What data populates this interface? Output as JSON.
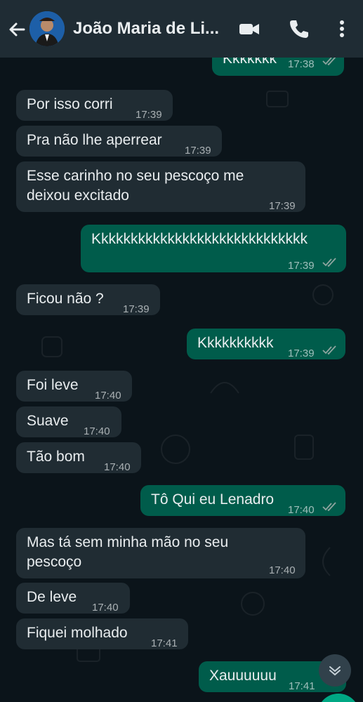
{
  "header": {
    "contact_name": "João Maria de Li..."
  },
  "messages": [
    {
      "text": "Kkkkkkk",
      "time": "17:38",
      "direction": "out"
    },
    {
      "text": "Por isso corri",
      "time": "17:39",
      "direction": "in"
    },
    {
      "text": "Pra não lhe aperrear",
      "time": "17:39",
      "direction": "in"
    },
    {
      "line1": "Esse carinho no seu pescoço me",
      "line2": "deixou excitado",
      "time": "17:39",
      "direction": "in"
    },
    {
      "text": "Kkkkkkkkkkkkkkkkkkkkkkkkkkkkk",
      "time": "17:39",
      "direction": "out"
    },
    {
      "text": "Ficou não ?",
      "time": "17:39",
      "direction": "in"
    },
    {
      "text": "Kkkkkkkkkk",
      "time": "17:39",
      "direction": "out"
    },
    {
      "text": "Foi leve",
      "time": "17:40",
      "direction": "in"
    },
    {
      "text": "Suave",
      "time": "17:40",
      "direction": "in"
    },
    {
      "text": "Tão bom",
      "time": "17:40",
      "direction": "in"
    },
    {
      "text": "Tô Qui eu Lenadro",
      "time": "17:40",
      "direction": "out"
    },
    {
      "line1": "Mas tá sem minha mão no seu",
      "line2": "pescoço",
      "time": "17:40",
      "direction": "in"
    },
    {
      "text": "De leve",
      "time": "17:40",
      "direction": "in"
    },
    {
      "text": "Fiquei molhado",
      "time": "17:41",
      "direction": "in"
    },
    {
      "text": "Xauuuuuu",
      "time": "17:41",
      "direction": "out"
    }
  ],
  "icons": {
    "back": "arrow-left-icon",
    "video": "video-camera-icon",
    "phone": "phone-icon",
    "menu": "more-vertical-icon",
    "scroll": "chevron-down-icon",
    "read_receipt": "double-check-icon"
  },
  "colors": {
    "header": "#1f2c34",
    "background": "#0b141a",
    "incoming": "#202c33",
    "outgoing": "#005c4b",
    "accent": "#00a884"
  }
}
